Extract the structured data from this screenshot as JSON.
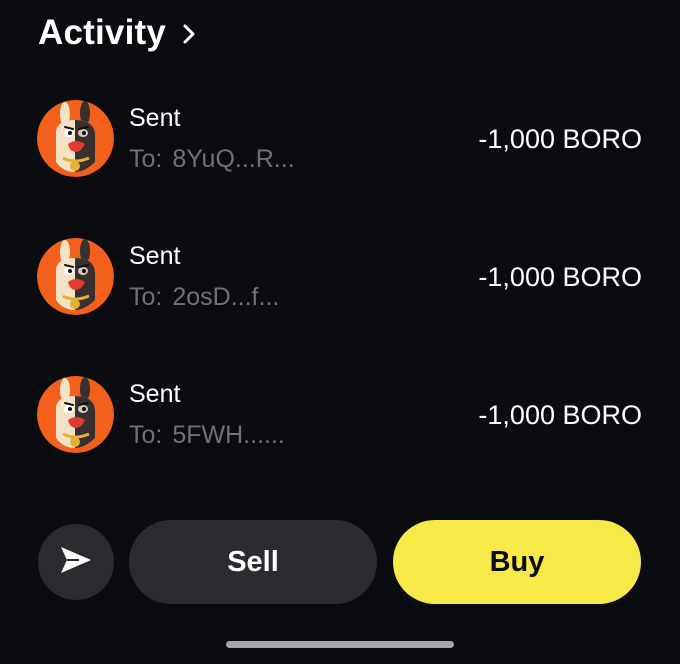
{
  "header": {
    "title": "Activity",
    "chevron_icon": "chevron-right-icon"
  },
  "activity": [
    {
      "type": "Sent",
      "to_label": "To:",
      "to_address": "8YuQ...R...",
      "amount": "-1,000 BORO",
      "avatar_icon": "token-avatar-icon"
    },
    {
      "type": "Sent",
      "to_label": "To:",
      "to_address": "2osD...f...",
      "amount": "-1,000 BORO",
      "avatar_icon": "token-avatar-icon"
    },
    {
      "type": "Sent",
      "to_label": "To:",
      "to_address": "5FWH......",
      "amount": "-1,000 BORO",
      "avatar_icon": "token-avatar-icon"
    }
  ],
  "actions": {
    "send_icon": "send-icon",
    "sell_label": "Sell",
    "buy_label": "Buy"
  },
  "colors": {
    "background": "#0b0c0f",
    "secondary_button": "#2a2c31",
    "buy_accent": "#f7ea48",
    "muted_text": "#6f7177",
    "avatar_orange": "#f2601c"
  }
}
